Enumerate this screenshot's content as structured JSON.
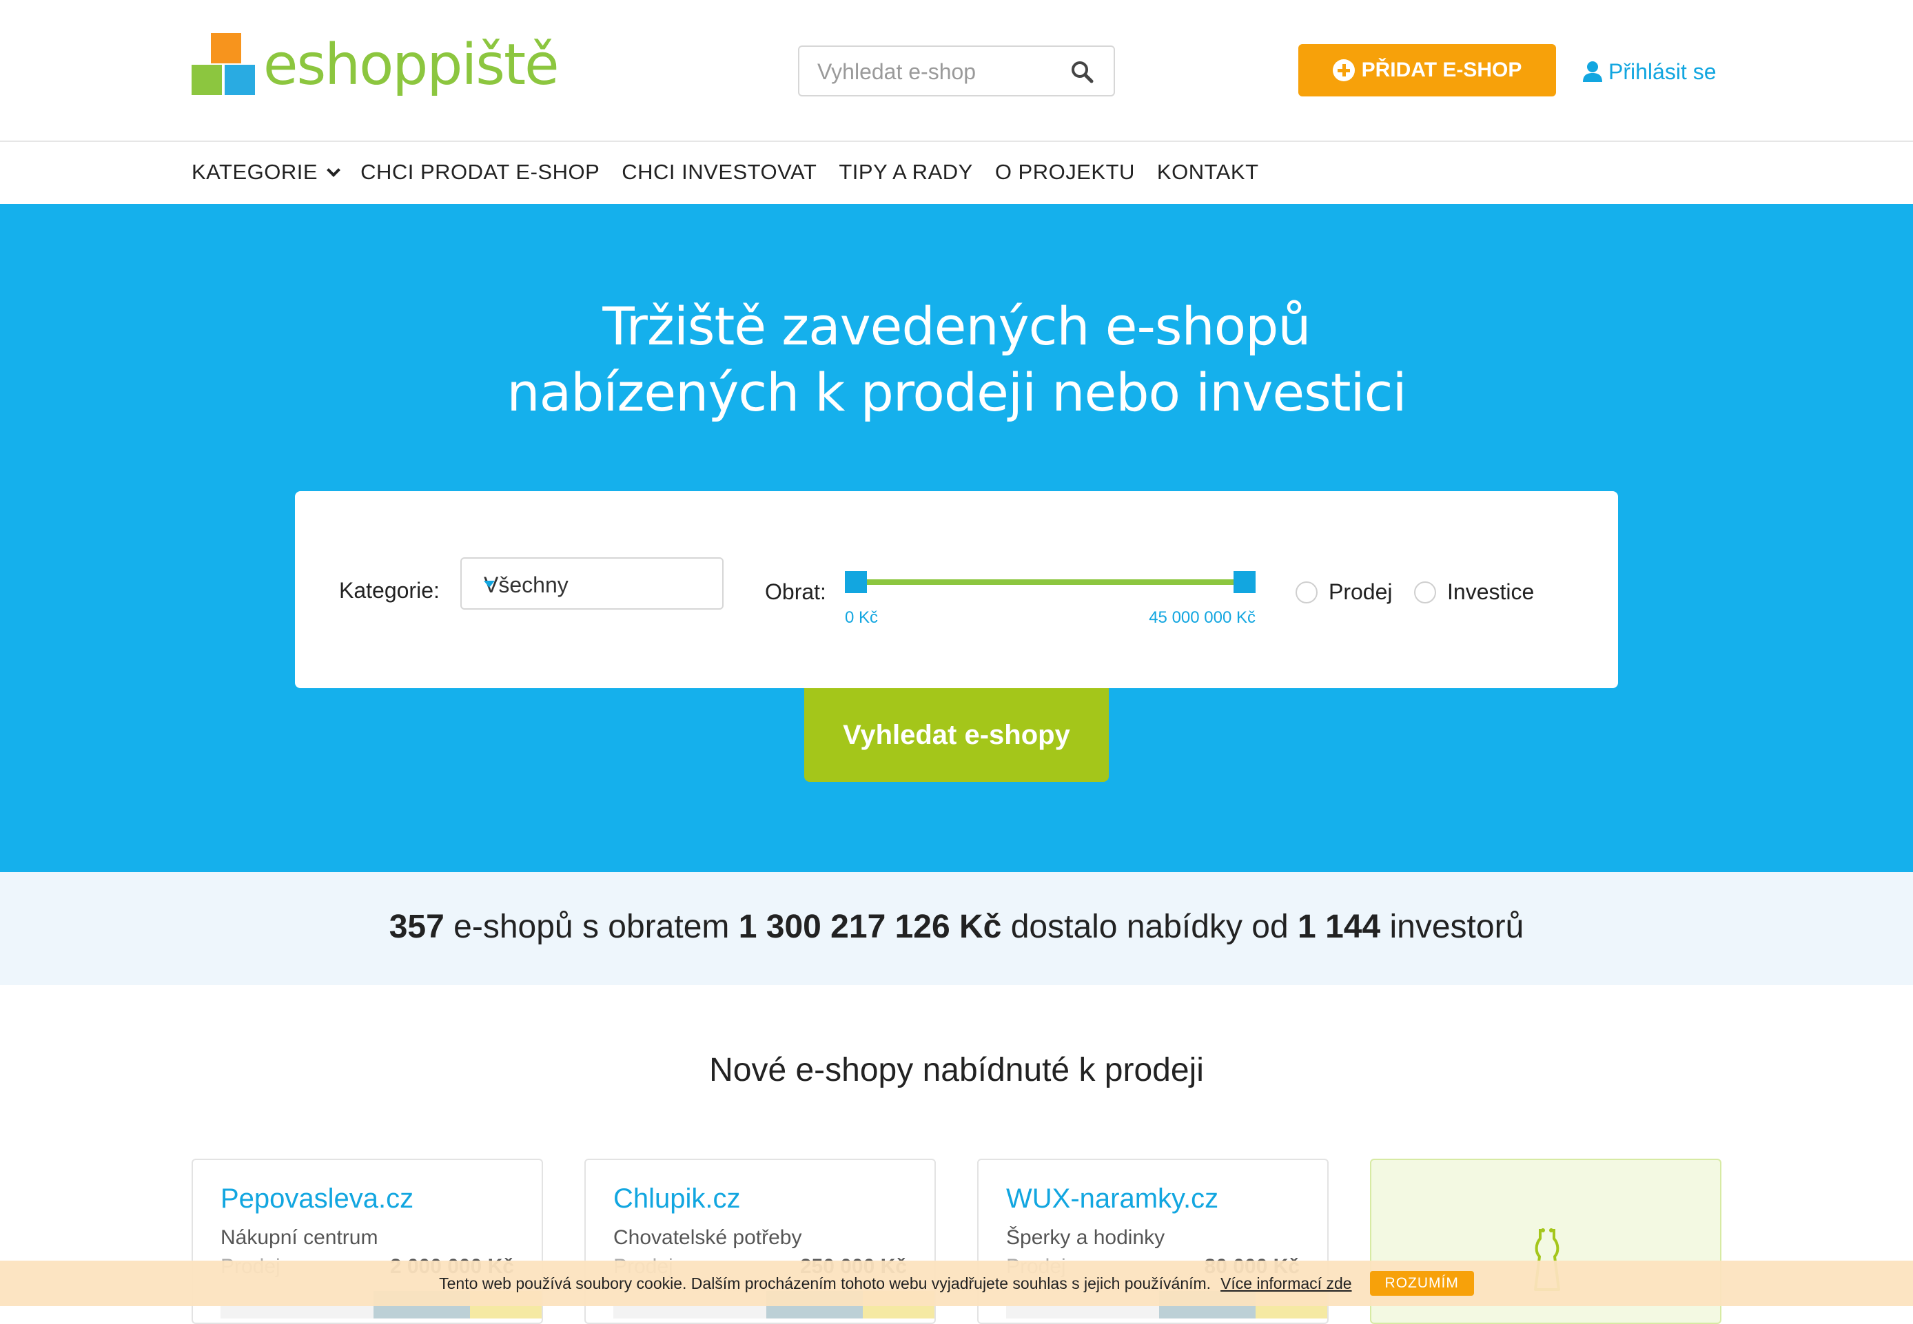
{
  "header": {
    "logo_text_a": "eshop",
    "logo_text_b": "iště",
    "search_placeholder": "Vyhledat e-shop",
    "add_button": "PŘIDAT E-SHOP",
    "login": "Přihlásit se",
    "accent_color": "#15b0ec",
    "cta_color": "#f7a10a"
  },
  "nav": {
    "items": [
      "KATEGORIE",
      "CHCI PRODAT E-SHOP",
      "CHCI INVESTOVAT",
      "TIPY A RADY",
      "O PROJEKTU",
      "KONTAKT"
    ]
  },
  "hero": {
    "title_line1": "Tržiště zavedených e-shopů",
    "title_line2": "nabízených k prodeji nebo investici",
    "filter": {
      "category_label": "Kategorie:",
      "category_value": "Všechny",
      "turnover_label": "Obrat:",
      "turnover_min": "0 Kč",
      "turnover_max": "45 000 000 Kč",
      "radio_sale": "Prodej",
      "radio_invest": "Investice"
    },
    "search_button": "Vyhledat e-shopy"
  },
  "stats": {
    "shops": "357",
    "text1": "e-shopů s obratem",
    "turnover": "1 300 217 126 Kč",
    "text2": "dostalo nabídky od",
    "investors": "1 144",
    "text3": "investorů"
  },
  "section": {
    "title": "Nové e-shopy nabídnuté k prodeji"
  },
  "cards": [
    {
      "name": "Pepovasleva.cz",
      "category": "Nákupní centrum",
      "type": "Prodej",
      "price": "2 000 000 Kč"
    },
    {
      "name": "Chlupik.cz",
      "category": "Chovatelské potřeby",
      "type": "Prodej",
      "price": "250 000 Kč"
    },
    {
      "name": "WUX-naramky.cz",
      "category": "Šperky a hodinky",
      "type": "Prodej",
      "price": "80 000 Kč"
    }
  ],
  "cookie": {
    "text": "Tento web používá soubory cookie. Dalším procházením tohoto webu vyjadřujete souhlas s jejich používáním.",
    "link": "Více informací zde",
    "button": "ROZUMÍM"
  }
}
